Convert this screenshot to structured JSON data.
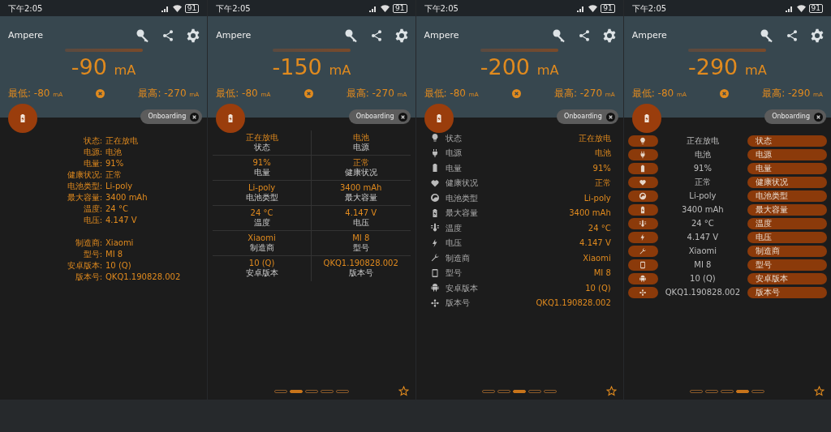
{
  "panels": [
    {
      "status": {
        "time": "下午2:05",
        "battery": "91"
      },
      "title": "Ampere",
      "current": {
        "value": "-90",
        "unit": "mA"
      },
      "min": {
        "label": "最低:",
        "value": "-80",
        "unit": "mA"
      },
      "max": {
        "label": "最高:",
        "value": "-270",
        "unit": "mA"
      },
      "chip": "Onboarding",
      "kind": "text",
      "groups": [
        [
          {
            "label": "状态:",
            "value": "正在放电"
          },
          {
            "label": "电源:",
            "value": "电池"
          },
          {
            "label": "电量:",
            "value": "91%"
          },
          {
            "label": "健康状况:",
            "value": "正常"
          },
          {
            "label": "电池类型:",
            "value": "Li-poly"
          },
          {
            "label": "最大容量:",
            "value": "3400 mAh"
          },
          {
            "label": "温度:",
            "value": "24 °C"
          },
          {
            "label": "电压:",
            "value": "4.147 V"
          }
        ],
        [
          {
            "label": "制造商:",
            "value": "Xiaomi"
          },
          {
            "label": "型号:",
            "value": "MI 8"
          },
          {
            "label": "安卓版本:",
            "value": "10 (Q)"
          },
          {
            "label": "版本号:",
            "value": "QKQ1.190828.002"
          }
        ]
      ]
    },
    {
      "status": {
        "time": "下午2:05",
        "battery": "91"
      },
      "title": "Ampere",
      "current": {
        "value": "-150",
        "unit": "mA"
      },
      "min": {
        "label": "最低:",
        "value": "-80",
        "unit": "mA"
      },
      "max": {
        "label": "最高:",
        "value": "-270",
        "unit": "mA"
      },
      "chip": "Onboarding",
      "kind": "grid",
      "items": [
        {
          "label": "状态",
          "value": "正在放电"
        },
        {
          "label": "电源",
          "value": "电池"
        },
        {
          "label": "电量",
          "value": "91%"
        },
        {
          "label": "健康状况",
          "value": "正常"
        },
        {
          "label": "电池类型",
          "value": "Li-poly"
        },
        {
          "label": "最大容量",
          "value": "3400 mAh"
        },
        {
          "label": "温度",
          "value": "24 °C"
        },
        {
          "label": "电压",
          "value": "4.147 V"
        },
        {
          "label": "制造商",
          "value": "Xiaomi"
        },
        {
          "label": "型号",
          "value": "MI 8"
        },
        {
          "label": "安卓版本",
          "value": "10 (Q)"
        },
        {
          "label": "版本号",
          "value": "QKQ1.190828.002"
        }
      ],
      "pages": [
        {
          "selected": false
        },
        {
          "selected": true
        },
        {
          "selected": false
        },
        {
          "selected": false
        },
        {
          "selected": false
        }
      ]
    },
    {
      "status": {
        "time": "下午2:05",
        "battery": "91"
      },
      "title": "Ampere",
      "current": {
        "value": "-200",
        "unit": "mA"
      },
      "min": {
        "label": "最低:",
        "value": "-80",
        "unit": "mA"
      },
      "max": {
        "label": "最高:",
        "value": "-270",
        "unit": "mA"
      },
      "chip": "Onboarding",
      "kind": "list",
      "items": [
        {
          "label": "状态",
          "value": "正在放电"
        },
        {
          "label": "电源",
          "value": "电池"
        },
        {
          "label": "电量",
          "value": "91%"
        },
        {
          "label": "健康状况",
          "value": "正常"
        },
        {
          "label": "电池类型",
          "value": "Li-poly"
        },
        {
          "label": "最大容量",
          "value": "3400 mAh"
        },
        {
          "label": "温度",
          "value": "24 °C"
        },
        {
          "label": "电压",
          "value": "4.147 V"
        },
        {
          "label": "制造商",
          "value": "Xiaomi"
        },
        {
          "label": "型号",
          "value": "MI 8"
        },
        {
          "label": "安卓版本",
          "value": "10 (Q)"
        },
        {
          "label": "版本号",
          "value": "QKQ1.190828.002"
        }
      ],
      "pages": [
        {
          "selected": false
        },
        {
          "selected": false
        },
        {
          "selected": true
        },
        {
          "selected": false
        },
        {
          "selected": false
        }
      ]
    },
    {
      "status": {
        "time": "下午2:05",
        "battery": "91"
      },
      "title": "Ampere",
      "current": {
        "value": "-290",
        "unit": "mA"
      },
      "min": {
        "label": "最低:",
        "value": "-80",
        "unit": "mA"
      },
      "max": {
        "label": "最高:",
        "value": "-290",
        "unit": "mA"
      },
      "chip": "Onboarding",
      "kind": "pills",
      "items": [
        {
          "label": "状态",
          "value": "正在放电"
        },
        {
          "label": "电源",
          "value": "电池"
        },
        {
          "label": "电量",
          "value": "91%"
        },
        {
          "label": "健康状况",
          "value": "正常"
        },
        {
          "label": "电池类型",
          "value": "Li-poly"
        },
        {
          "label": "最大容量",
          "value": "3400 mAh"
        },
        {
          "label": "温度",
          "value": "24 °C"
        },
        {
          "label": "电压",
          "value": "4.147 V"
        },
        {
          "label": "制造商",
          "value": "Xiaomi"
        },
        {
          "label": "型号",
          "value": "MI 8"
        },
        {
          "label": "安卓版本",
          "value": "10 (Q)"
        },
        {
          "label": "版本号",
          "value": "QKQ1.190828.002"
        }
      ],
      "pages": [
        {
          "selected": false
        },
        {
          "selected": false
        },
        {
          "selected": false
        },
        {
          "selected": true
        },
        {
          "selected": false
        }
      ]
    }
  ]
}
